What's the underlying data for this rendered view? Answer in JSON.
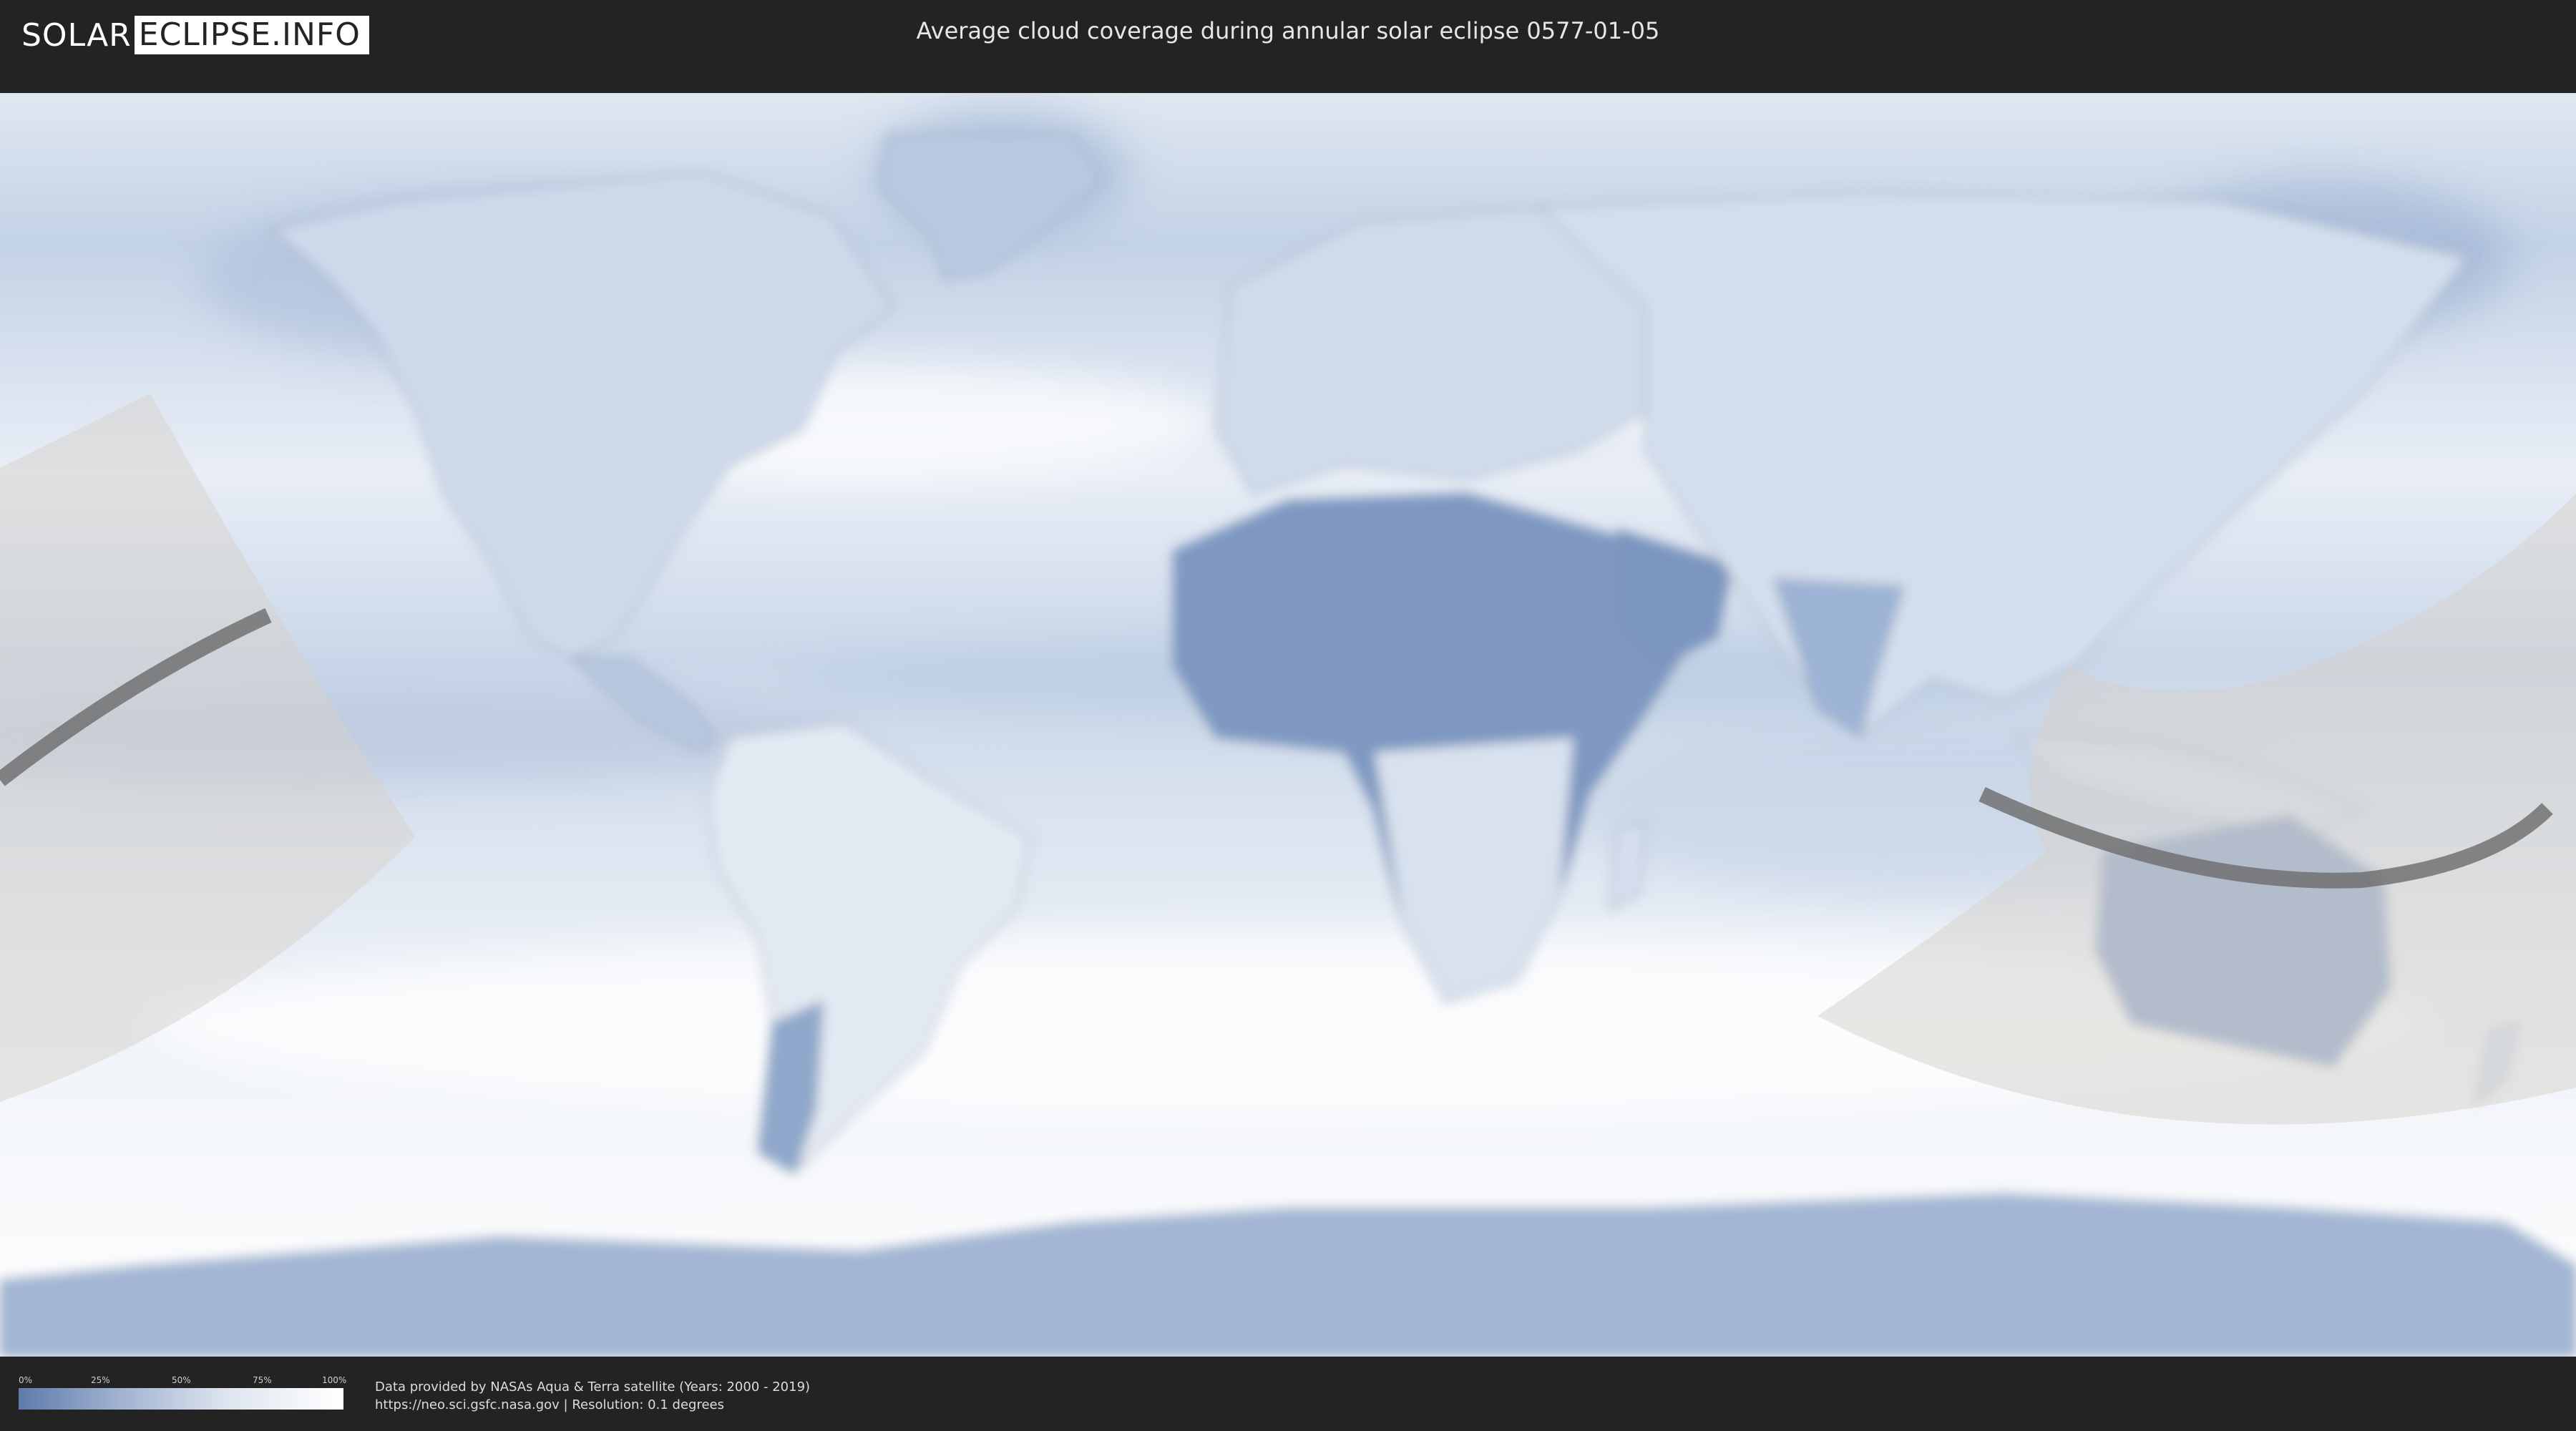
{
  "header": {
    "logo_left": "SOLAR",
    "logo_right": "ECLIPSE.INFO",
    "title": "Average cloud coverage during annular solar eclipse 0577-01-05"
  },
  "map": {
    "projection": "equirectangular",
    "layer": "average cloud coverage",
    "colors": {
      "clear_sky": "#5f7bab",
      "cloud": "#ffffff",
      "eclipse_zone": "#d6d2cc",
      "central_path": "#6c6c6c"
    }
  },
  "legend": {
    "ticks": [
      "0%",
      "25%",
      "50%",
      "75%",
      "100%"
    ]
  },
  "footer": {
    "line1": "Data provided by NASAs Aqua & Terra satellite (Years: 2000 - 2019)",
    "line2": "https://neo.sci.gsfc.nasa.gov | Resolution: 0.1 degrees"
  }
}
